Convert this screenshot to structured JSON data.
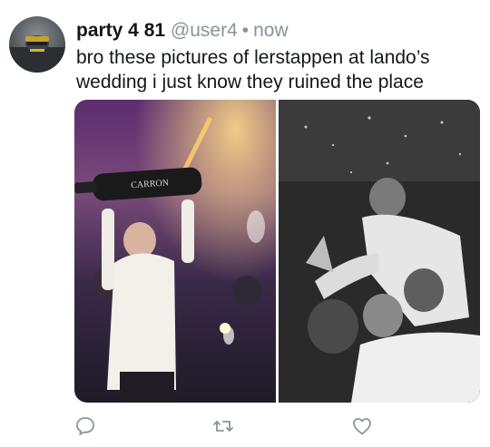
{
  "user": {
    "display_name": "party 4 81",
    "handle": "@user4",
    "separator": "•",
    "timestamp": "now"
  },
  "tweet": {
    "text": "bro these pictures of lerstappen at lando’s wedding i just know they ruined the place"
  },
  "media": {
    "images": [
      {
        "icon": "photo-nightclub-celebration",
        "bottle_label": "CARRON"
      },
      {
        "icon": "photo-black-and-white-lift"
      }
    ]
  },
  "actions": [
    {
      "icon": "reply-icon"
    },
    {
      "icon": "retweet-icon"
    },
    {
      "icon": "like-icon"
    }
  ],
  "colors": {
    "text": "#14171a",
    "secondary": "#8a939b",
    "background": "#ffffff"
  }
}
